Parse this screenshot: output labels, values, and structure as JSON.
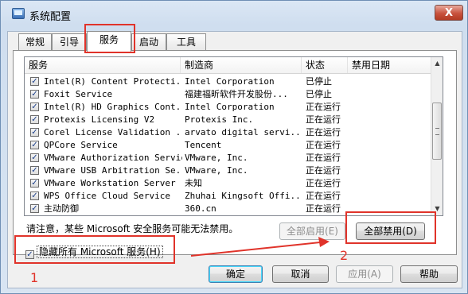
{
  "window": {
    "title": "系统配置",
    "close_label": "X"
  },
  "tabs": [
    {
      "label": "常规",
      "active": false
    },
    {
      "label": "引导",
      "active": false
    },
    {
      "label": "服务",
      "active": true
    },
    {
      "label": "启动",
      "active": false
    },
    {
      "label": "工具",
      "active": false
    }
  ],
  "services": {
    "columns": [
      "服务",
      "制造商",
      "状态",
      "禁用日期"
    ],
    "rows": [
      {
        "name": "Intel(R) Content Protecti...",
        "maker": "Intel Corporation",
        "status": "已停止",
        "checked": true
      },
      {
        "name": "Foxit Service",
        "maker": "福建福昕软件开发股份...",
        "status": "已停止",
        "checked": true
      },
      {
        "name": "Intel(R) HD Graphics Cont...",
        "maker": "Intel Corporation",
        "status": "正在运行",
        "checked": true
      },
      {
        "name": "Protexis Licensing V2",
        "maker": "Protexis Inc.",
        "status": "正在运行",
        "checked": true
      },
      {
        "name": "Corel License Validation ...",
        "maker": "arvato digital servi...",
        "status": "正在运行",
        "checked": true
      },
      {
        "name": "QPCore Service",
        "maker": "Tencent",
        "status": "正在运行",
        "checked": true
      },
      {
        "name": "VMware Authorization Service",
        "maker": "VMware, Inc.",
        "status": "正在运行",
        "checked": true
      },
      {
        "name": "VMware USB Arbitration Se...",
        "maker": "VMware, Inc.",
        "status": "正在运行",
        "checked": true
      },
      {
        "name": "VMware Workstation Server",
        "maker": "未知",
        "status": "正在运行",
        "checked": true
      },
      {
        "name": "WPS Office Cloud Service",
        "maker": "Zhuhai Kingsoft Offi...",
        "status": "正在运行",
        "checked": true
      },
      {
        "name": "主动防御",
        "maker": "360.cn",
        "status": "正在运行",
        "checked": true
      }
    ]
  },
  "note": "请注意，某些 Microsoft 安全服务可能无法禁用。",
  "buttons": {
    "enable_all": "全部启用(E)",
    "disable_all": "全部禁用(D)",
    "ok": "确定",
    "cancel": "取消",
    "apply": "应用(A)",
    "help": "帮助"
  },
  "hide_ms": {
    "label": "隐藏所有 Microsoft 服务(H)",
    "checked": true
  },
  "annotations": {
    "marker_1": "1",
    "marker_2": "2",
    "color": "#e0332a"
  }
}
